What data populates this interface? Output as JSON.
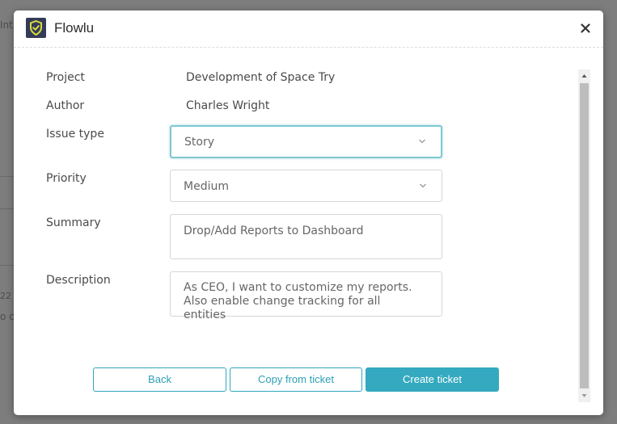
{
  "background": {
    "fragments": [
      "Int",
      "22",
      "o c"
    ]
  },
  "app": {
    "title": "Flowlu"
  },
  "form": {
    "project_label": "Project",
    "project_value": "Development of Space Try",
    "author_label": "Author",
    "author_value": "Charles Wright",
    "issue_type_label": "Issue type",
    "issue_type_value": "Story",
    "priority_label": "Priority",
    "priority_value": "Medium",
    "summary_label": "Summary",
    "summary_value": "Drop/Add Reports to Dashboard",
    "description_label": "Description",
    "description_value": "As CEO, I want to customize my reports. Also enable change tracking for all entities"
  },
  "buttons": {
    "back": "Back",
    "copy": "Copy from ticket",
    "create": "Create ticket"
  },
  "colors": {
    "accent": "#34a9bf",
    "logo_bg": "#343b58",
    "logo_check": "#d8dc3c"
  }
}
